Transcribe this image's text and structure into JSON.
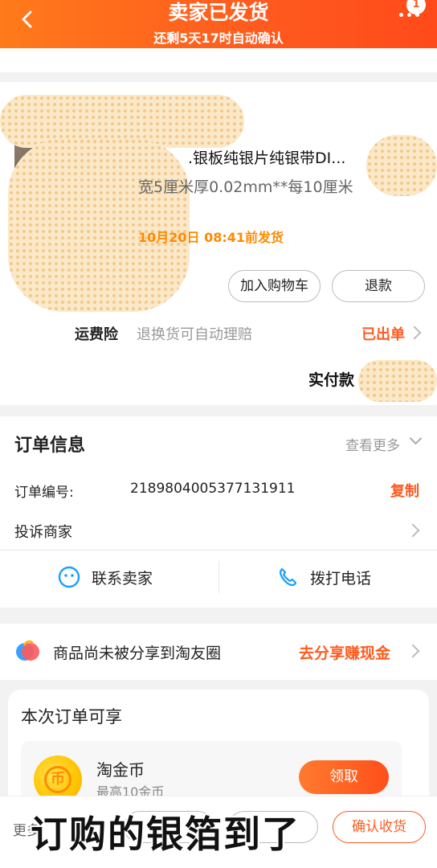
{
  "header": {
    "title": "卖家已发货",
    "subtitle": "还剩5天17时自动确认",
    "badge": "1",
    "color": "#ff5a1f"
  },
  "product": {
    "title": ".银板纯银片纯银带DI...",
    "spec": "宽5厘米厚0.02mm**每10厘米",
    "ship_by": "10月20日 08:41前发货",
    "add_cart_label": "加入购物车",
    "refund_label": "退款",
    "freight_label": "运费险",
    "freight_desc": "退换货可自动理赔",
    "freight_status": "已出单",
    "paid_label": "实付款"
  },
  "order_info": {
    "heading": "订单信息",
    "view_more": "查看更多",
    "order_no_label": "订单编号:",
    "order_no": "2189804005377131911",
    "copy_label": "复制",
    "complain_label": "投诉商家",
    "contact_seller": "联系卖家",
    "call_phone": "拨打电话"
  },
  "share": {
    "text": "商品尚未被分享到淘友圈",
    "cta": "去分享赚现金"
  },
  "benefit": {
    "heading": "本次订单可享",
    "coin_title": "淘金币",
    "coin_sub": "最高10金币",
    "coin_glyph": "币",
    "claim_label": "领取"
  },
  "bottom": {
    "more": "更多",
    "confirm_label": "确认收货"
  },
  "caption": "订购的银箔到了"
}
